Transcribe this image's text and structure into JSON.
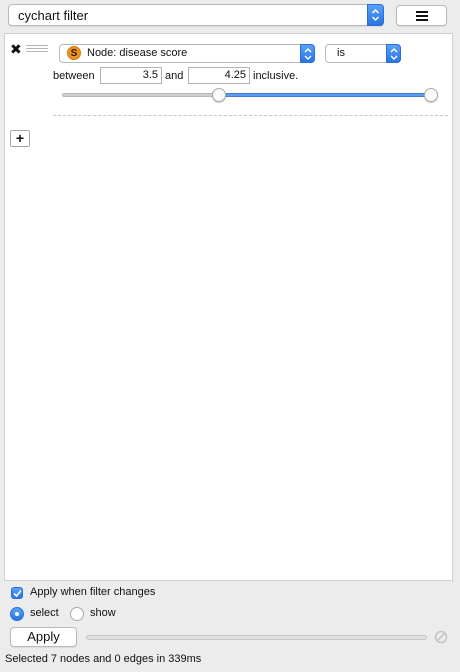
{
  "header": {
    "filter_name": "cychart filter",
    "menu_icon": "hamburger-icon"
  },
  "filter": {
    "remove_icon": "close-icon",
    "drag_icon": "drag-handle-icon",
    "column_type_badge": "S",
    "column": "Node: disease score",
    "predicate": "is",
    "between_label": "between",
    "min_value": "3.5",
    "and_label": "and",
    "max_value": "4.25",
    "inclusive_label": "inclusive.",
    "range_low_fraction": 0.415,
    "range_high_fraction": 1.0
  },
  "add_button_label": "+",
  "footer": {
    "apply_when_changes_label": "Apply when filter changes",
    "apply_when_changes_checked": true,
    "mode_select_label": "select",
    "mode_show_label": "show",
    "selected_mode": "select",
    "apply_label": "Apply",
    "progress": 0,
    "status": "Selected 7 nodes and 0 edges in 339ms"
  },
  "colors": {
    "accent": "#2a74e6",
    "badge": "#f0901e"
  }
}
